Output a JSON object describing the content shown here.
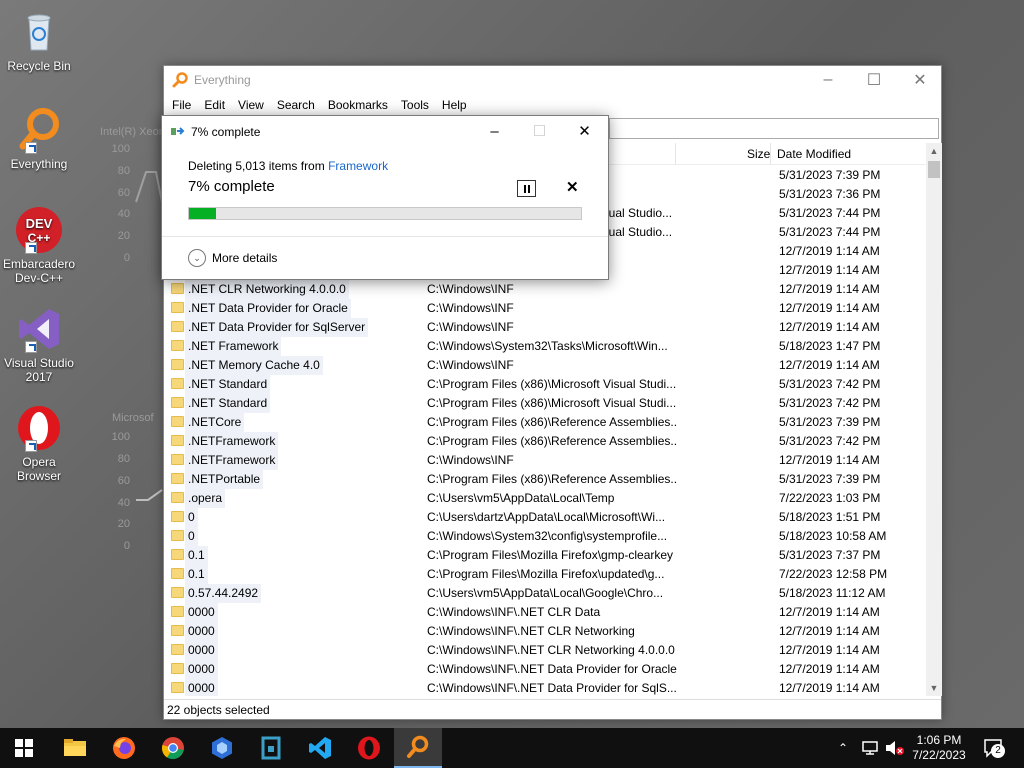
{
  "desktop": {
    "icons": [
      {
        "label": "Recycle Bin"
      },
      {
        "label": "Everything"
      },
      {
        "label": "Embarcadero Dev-C++"
      },
      {
        "label": "Visual Studio 2017"
      },
      {
        "label": "Opera Browser"
      }
    ],
    "bg_chart1": {
      "title": "Intel(R) Xeon",
      "ticks": [
        "100",
        "80",
        "60",
        "40",
        "20",
        "0"
      ]
    },
    "bg_chart2": {
      "title": "Microsof",
      "ticks": [
        "100",
        "80",
        "60",
        "40",
        "20",
        "0"
      ]
    }
  },
  "main_window": {
    "title": "Everything",
    "menu": [
      "File",
      "Edit",
      "View",
      "Search",
      "Bookmarks",
      "Tools",
      "Help"
    ],
    "columns": {
      "size": "Size",
      "date_modified": "Date Modified"
    },
    "rows": [
      {
        "name": "",
        "path": "",
        "date": "5/31/2023 7:39 PM"
      },
      {
        "name": "",
        "path": "",
        "date": "5/31/2023 7:36 PM"
      },
      {
        "name": "",
        "path": "isual Studio...",
        "date": "5/31/2023 7:44 PM"
      },
      {
        "name": "",
        "path": "isual Studio...",
        "date": "5/31/2023 7:44 PM"
      },
      {
        "name": "",
        "path": "",
        "date": "12/7/2019 1:14 AM"
      },
      {
        "name": "",
        "path": "",
        "date": "12/7/2019 1:14 AM"
      },
      {
        "name": ".NET CLR Networking 4.0.0.0",
        "path": "C:\\Windows\\INF",
        "date": "12/7/2019 1:14 AM"
      },
      {
        "name": ".NET Data Provider for Oracle",
        "path": "C:\\Windows\\INF",
        "date": "12/7/2019 1:14 AM"
      },
      {
        "name": ".NET Data Provider for SqlServer",
        "path": "C:\\Windows\\INF",
        "date": "12/7/2019 1:14 AM"
      },
      {
        "name": ".NET Framework",
        "path": "C:\\Windows\\System32\\Tasks\\Microsoft\\Win...",
        "date": "5/18/2023 1:47 PM"
      },
      {
        "name": ".NET Memory Cache 4.0",
        "path": "C:\\Windows\\INF",
        "date": "12/7/2019 1:14 AM"
      },
      {
        "name": ".NET Standard",
        "path": "C:\\Program Files (x86)\\Microsoft Visual Studi...",
        "date": "5/31/2023 7:42 PM"
      },
      {
        "name": ".NET Standard",
        "path": "C:\\Program Files (x86)\\Microsoft Visual Studi...",
        "date": "5/31/2023 7:42 PM"
      },
      {
        "name": ".NETCore",
        "path": "C:\\Program Files (x86)\\Reference Assemblies...",
        "date": "5/31/2023 7:39 PM"
      },
      {
        "name": ".NETFramework",
        "path": "C:\\Program Files (x86)\\Reference Assemblies...",
        "date": "5/31/2023 7:42 PM"
      },
      {
        "name": ".NETFramework",
        "path": "C:\\Windows\\INF",
        "date": "12/7/2019 1:14 AM"
      },
      {
        "name": ".NETPortable",
        "path": "C:\\Program Files (x86)\\Reference Assemblies...",
        "date": "5/31/2023 7:39 PM"
      },
      {
        "name": ".opera",
        "path": "C:\\Users\\vm5\\AppData\\Local\\Temp",
        "date": "7/22/2023 1:03 PM"
      },
      {
        "name": "0",
        "path": "C:\\Users\\dartz\\AppData\\Local\\Microsoft\\Wi...",
        "date": "5/18/2023 1:51 PM"
      },
      {
        "name": "0",
        "path": "C:\\Windows\\System32\\config\\systemprofile...",
        "date": "5/18/2023 10:58 AM"
      },
      {
        "name": "0.1",
        "path": "C:\\Program Files\\Mozilla Firefox\\gmp-clearkey",
        "date": "5/31/2023 7:37 PM"
      },
      {
        "name": "0.1",
        "path": "C:\\Program Files\\Mozilla Firefox\\updated\\g...",
        "date": "7/22/2023 12:58 PM"
      },
      {
        "name": "0.57.44.2492",
        "path": "C:\\Users\\vm5\\AppData\\Local\\Google\\Chro...",
        "date": "5/18/2023 11:12 AM"
      },
      {
        "name": "0000",
        "path": "C:\\Windows\\INF\\.NET CLR Data",
        "date": "12/7/2019 1:14 AM"
      },
      {
        "name": "0000",
        "path": "C:\\Windows\\INF\\.NET CLR Networking",
        "date": "12/7/2019 1:14 AM"
      },
      {
        "name": "0000",
        "path": "C:\\Windows\\INF\\.NET CLR Networking 4.0.0.0",
        "date": "12/7/2019 1:14 AM"
      },
      {
        "name": "0000",
        "path": "C:\\Windows\\INF\\.NET Data Provider for Oracle",
        "date": "12/7/2019 1:14 AM"
      },
      {
        "name": "0000",
        "path": "C:\\Windows\\INF\\.NET Data Provider for SqlS...",
        "date": "12/7/2019 1:14 AM"
      }
    ],
    "status": "22 objects selected"
  },
  "dialog": {
    "title": "7% complete",
    "deleting_prefix": "Deleting 5,013 items from ",
    "deleting_target": "Framework",
    "progress_text": "7% complete",
    "progress_fraction": 0.07,
    "more_details": "More details"
  },
  "taskbar": {
    "time": "1:06 PM",
    "date": "7/22/2023",
    "notification_count": "2"
  },
  "colors": {
    "progress_fill": "#06b025",
    "link": "#1a67c8",
    "accent": "#7fb8f0"
  }
}
